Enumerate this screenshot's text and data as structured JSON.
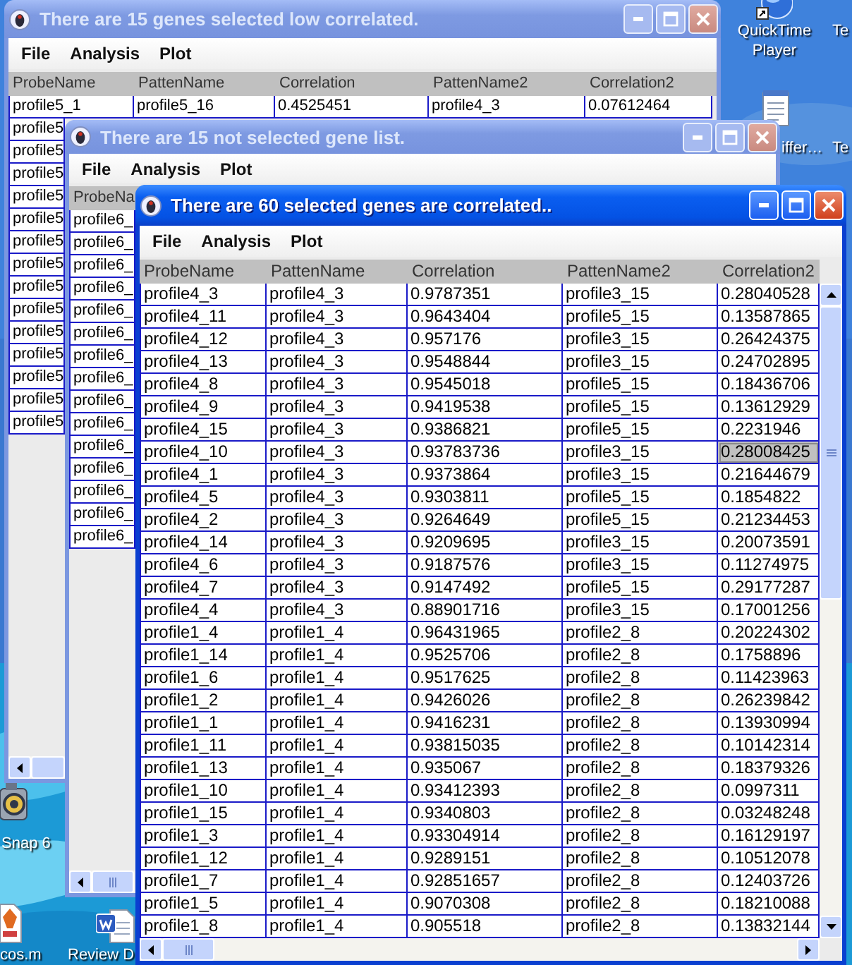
{
  "windows": [
    {
      "title": "There are 15 genes selected low correlated.",
      "active": false,
      "menu": [
        "File",
        "Analysis",
        "Plot"
      ],
      "table": {
        "columns": [
          "ProbeName",
          "PattenName",
          "Correlation",
          "PattenName2",
          "Correlation2"
        ],
        "rows": [
          {
            "cells": [
              "profile5_1",
              "profile5_16",
              "0.4525451",
              "profile4_3",
              "0.07612464"
            ]
          },
          {
            "cells": [
              "profile5"
            ]
          },
          {
            "cells": [
              "profile5"
            ]
          },
          {
            "cells": [
              "profile5"
            ]
          },
          {
            "cells": [
              "profile5"
            ]
          },
          {
            "cells": [
              "profile5"
            ]
          },
          {
            "cells": [
              "profile5"
            ]
          },
          {
            "cells": [
              "profile5"
            ]
          },
          {
            "cells": [
              "profile5"
            ]
          },
          {
            "cells": [
              "profile5"
            ]
          },
          {
            "cells": [
              "profile5"
            ]
          },
          {
            "cells": [
              "profile5"
            ]
          },
          {
            "cells": [
              "profile5"
            ]
          },
          {
            "cells": [
              "profile5"
            ]
          },
          {
            "cells": [
              "profile5"
            ]
          }
        ]
      }
    },
    {
      "title": "There are 15 not selected gene list.",
      "active": false,
      "menu": [
        "File",
        "Analysis",
        "Plot"
      ],
      "table": {
        "columns": [
          "ProbeNa"
        ],
        "rows": [
          {
            "cells": [
              "profile6_"
            ]
          },
          {
            "cells": [
              "profile6_"
            ]
          },
          {
            "cells": [
              "profile6_"
            ]
          },
          {
            "cells": [
              "profile6_"
            ]
          },
          {
            "cells": [
              "profile6_"
            ]
          },
          {
            "cells": [
              "profile6_"
            ]
          },
          {
            "cells": [
              "profile6_"
            ]
          },
          {
            "cells": [
              "profile6_"
            ]
          },
          {
            "cells": [
              "profile6_"
            ]
          },
          {
            "cells": [
              "profile6_"
            ]
          },
          {
            "cells": [
              "profile6_"
            ]
          },
          {
            "cells": [
              "profile6_"
            ]
          },
          {
            "cells": [
              "profile6_"
            ]
          },
          {
            "cells": [
              "profile6_"
            ]
          },
          {
            "cells": [
              "profile6_"
            ]
          }
        ]
      }
    },
    {
      "title": "There are 60 selected genes are correlated..",
      "active": true,
      "menu": [
        "File",
        "Analysis",
        "Plot"
      ],
      "table": {
        "columns": [
          "ProbeName",
          "PattenName",
          "Correlation",
          "PattenName2",
          "Correlation2"
        ],
        "rows": [
          {
            "cells": [
              "profile4_3",
              "profile4_3",
              "0.9787351",
              "profile3_15",
              "0.28040528"
            ],
            "selected": [
              false,
              false,
              false,
              false,
              false
            ]
          },
          {
            "cells": [
              "profile4_11",
              "profile4_3",
              "0.9643404",
              "profile5_15",
              "0.13587865"
            ],
            "selected": [
              false,
              false,
              false,
              false,
              false
            ]
          },
          {
            "cells": [
              "profile4_12",
              "profile4_3",
              "0.957176",
              "profile3_15",
              "0.26424375"
            ],
            "selected": [
              false,
              false,
              false,
              false,
              false
            ]
          },
          {
            "cells": [
              "profile4_13",
              "profile4_3",
              "0.9548844",
              "profile3_15",
              "0.24702895"
            ],
            "selected": [
              false,
              false,
              false,
              false,
              false
            ]
          },
          {
            "cells": [
              "profile4_8",
              "profile4_3",
              "0.9545018",
              "profile5_15",
              "0.18436706"
            ],
            "selected": [
              false,
              false,
              false,
              false,
              false
            ]
          },
          {
            "cells": [
              "profile4_9",
              "profile4_3",
              "0.9419538",
              "profile5_15",
              "0.13612929"
            ],
            "selected": [
              false,
              false,
              false,
              false,
              false
            ]
          },
          {
            "cells": [
              "profile4_15",
              "profile4_3",
              "0.9386821",
              "profile5_15",
              "0.2231946"
            ],
            "selected": [
              false,
              false,
              false,
              false,
              false
            ]
          },
          {
            "cells": [
              "profile4_10",
              "profile4_3",
              "0.93783736",
              "profile3_15",
              "0.28008425"
            ],
            "selected": [
              false,
              false,
              false,
              false,
              true
            ]
          },
          {
            "cells": [
              "profile4_1",
              "profile4_3",
              "0.9373864",
              "profile3_15",
              "0.21644679"
            ],
            "selected": [
              false,
              false,
              false,
              false,
              false
            ]
          },
          {
            "cells": [
              "profile4_5",
              "profile4_3",
              "0.9303811",
              "profile5_15",
              "0.1854822"
            ],
            "selected": [
              false,
              false,
              false,
              false,
              false
            ]
          },
          {
            "cells": [
              "profile4_2",
              "profile4_3",
              "0.9264649",
              "profile5_15",
              "0.21234453"
            ],
            "selected": [
              false,
              false,
              false,
              false,
              false
            ]
          },
          {
            "cells": [
              "profile4_14",
              "profile4_3",
              "0.9209695",
              "profile3_15",
              "0.20073591"
            ],
            "selected": [
              false,
              false,
              false,
              false,
              false
            ]
          },
          {
            "cells": [
              "profile4_6",
              "profile4_3",
              "0.9187576",
              "profile3_15",
              "0.11274975"
            ],
            "selected": [
              false,
              false,
              false,
              false,
              false
            ]
          },
          {
            "cells": [
              "profile4_7",
              "profile4_3",
              "0.9147492",
              "profile5_15",
              "0.29177287"
            ],
            "selected": [
              false,
              false,
              false,
              false,
              false
            ]
          },
          {
            "cells": [
              "profile4_4",
              "profile4_3",
              "0.88901716",
              "profile3_15",
              "0.17001256"
            ],
            "selected": [
              false,
              false,
              false,
              false,
              false
            ]
          },
          {
            "cells": [
              "profile1_4",
              "profile1_4",
              "0.96431965",
              "profile2_8",
              "0.20224302"
            ],
            "selected": [
              false,
              false,
              false,
              false,
              false
            ]
          },
          {
            "cells": [
              "profile1_14",
              "profile1_4",
              "0.9525706",
              "profile2_8",
              "0.1758896"
            ],
            "selected": [
              false,
              false,
              false,
              false,
              false
            ]
          },
          {
            "cells": [
              "profile1_6",
              "profile1_4",
              "0.9517625",
              "profile2_8",
              "0.11423963"
            ],
            "selected": [
              false,
              false,
              false,
              false,
              false
            ]
          },
          {
            "cells": [
              "profile1_2",
              "profile1_4",
              "0.9426026",
              "profile2_8",
              "0.26239842"
            ],
            "selected": [
              false,
              false,
              false,
              false,
              false
            ]
          },
          {
            "cells": [
              "profile1_1",
              "profile1_4",
              "0.9416231",
              "profile2_8",
              "0.13930994"
            ],
            "selected": [
              false,
              false,
              false,
              false,
              false
            ]
          },
          {
            "cells": [
              "profile1_11",
              "profile1_4",
              "0.93815035",
              "profile2_8",
              "0.10142314"
            ],
            "selected": [
              false,
              false,
              false,
              false,
              false
            ]
          },
          {
            "cells": [
              "profile1_13",
              "profile1_4",
              "0.935067",
              "profile2_8",
              "0.18379326"
            ],
            "selected": [
              false,
              false,
              false,
              false,
              false
            ]
          },
          {
            "cells": [
              "profile1_10",
              "profile1_4",
              "0.93412393",
              "profile2_8",
              "0.0997311"
            ],
            "selected": [
              false,
              false,
              false,
              false,
              false
            ]
          },
          {
            "cells": [
              "profile1_15",
              "profile1_4",
              "0.9340803",
              "profile2_8",
              "0.03248248"
            ],
            "selected": [
              false,
              false,
              false,
              false,
              false
            ]
          },
          {
            "cells": [
              "profile1_3",
              "profile1_4",
              "0.93304914",
              "profile2_8",
              "0.16129197"
            ],
            "selected": [
              false,
              false,
              false,
              false,
              false
            ]
          },
          {
            "cells": [
              "profile1_12",
              "profile1_4",
              "0.9289151",
              "profile2_8",
              "0.10512078"
            ],
            "selected": [
              false,
              false,
              false,
              false,
              false
            ]
          },
          {
            "cells": [
              "profile1_7",
              "profile1_4",
              "0.92851657",
              "profile2_8",
              "0.12403726"
            ],
            "selected": [
              false,
              false,
              false,
              false,
              false
            ]
          },
          {
            "cells": [
              "profile1_5",
              "profile1_4",
              "0.9070308",
              "profile2_8",
              "0.18210088"
            ],
            "selected": [
              false,
              false,
              false,
              false,
              false
            ]
          },
          {
            "cells": [
              "profile1_8",
              "profile1_4",
              "0.905518",
              "profile2_8",
              "0.13832144"
            ],
            "selected": [
              false,
              false,
              false,
              false,
              false
            ]
          }
        ]
      }
    }
  ],
  "desktop_icons": [
    {
      "kind": "sphere",
      "label": "QuickTime Player"
    },
    {
      "kind": "none",
      "label": "Te"
    },
    {
      "kind": "notepad",
      "label": "iffer…"
    },
    {
      "kind": "none",
      "label": "Te"
    },
    {
      "kind": "camera",
      "label": "Snap 6"
    },
    {
      "kind": "document",
      "label": "cos.m"
    },
    {
      "kind": "word",
      "label": "Review D"
    }
  ]
}
